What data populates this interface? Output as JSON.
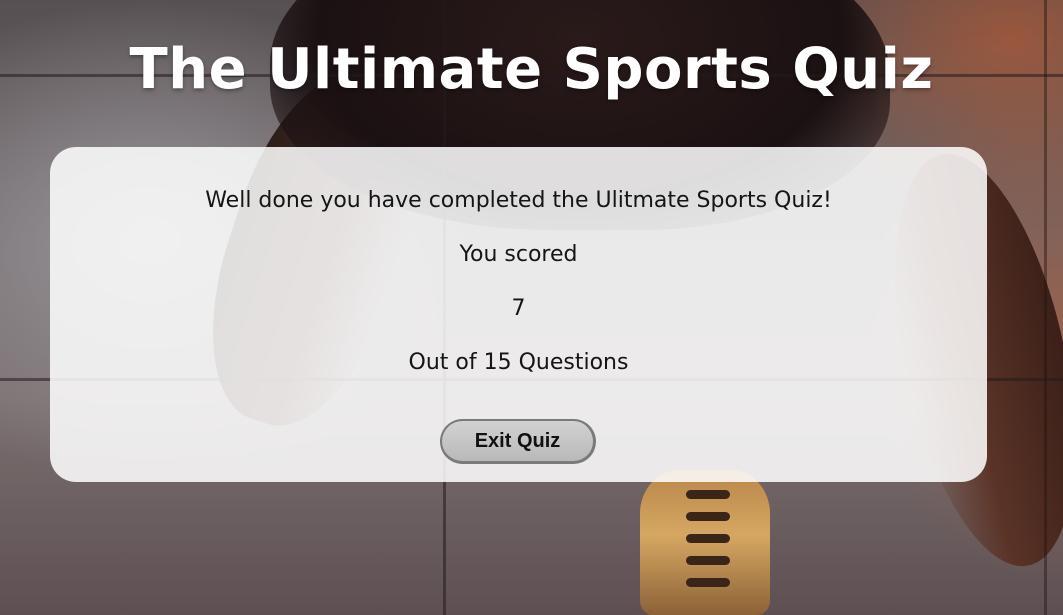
{
  "header": {
    "title": "The Ultimate Sports Quiz"
  },
  "result": {
    "completion_message": "Well done you have completed the Ulitmate Sports Quiz!",
    "scored_label": "You scored",
    "score": "7",
    "out_of_text": "Out of 15 Questions",
    "exit_button_label": "Exit Quiz"
  },
  "colors": {
    "title_text": "#ffffff",
    "card_background": "#ffffff",
    "button_background": "#c4c4c4"
  }
}
